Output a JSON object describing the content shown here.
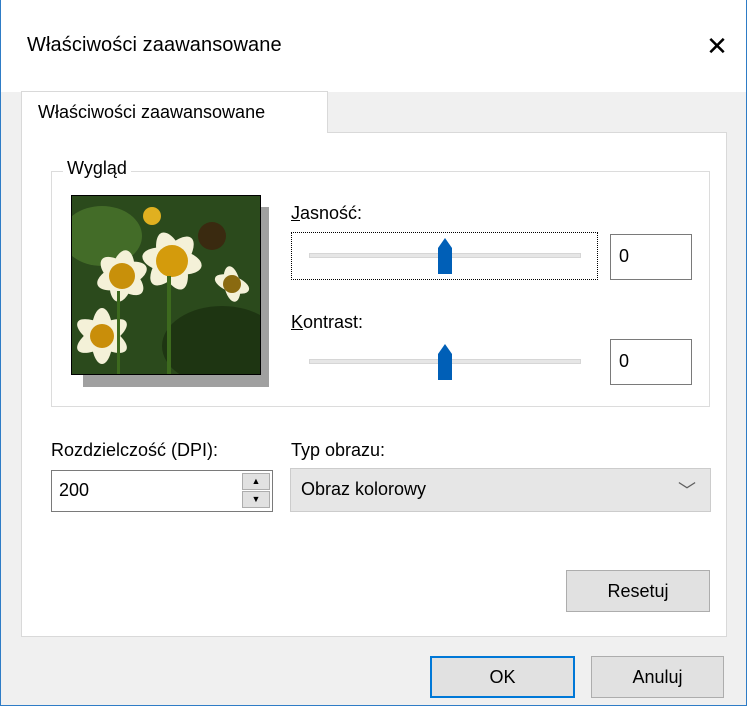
{
  "window": {
    "title": "Właściwości zaawansowane"
  },
  "tab": {
    "label": "Właściwości zaawansowane"
  },
  "appearance": {
    "group_label": "Wygląd",
    "brightness": {
      "label": "Jasność:",
      "value": "0",
      "level": 0.5
    },
    "contrast": {
      "label": "Kontrast:",
      "value": "0",
      "level": 0.5
    }
  },
  "resolution": {
    "label": "Rozdzielczość (DPI):",
    "value": "200"
  },
  "image_type": {
    "label": "Typ obrazu:",
    "value": "Obraz kolorowy"
  },
  "buttons": {
    "reset": "Resetuj",
    "ok": "OK",
    "cancel": "Anuluj"
  },
  "colors": {
    "accent": "#0078d7",
    "slider_thumb": "#005fb7"
  },
  "icons": {
    "close": "close-icon",
    "spin_up": "arrow-up-icon",
    "spin_down": "arrow-down-icon",
    "dropdown": "chevron-down-icon"
  }
}
